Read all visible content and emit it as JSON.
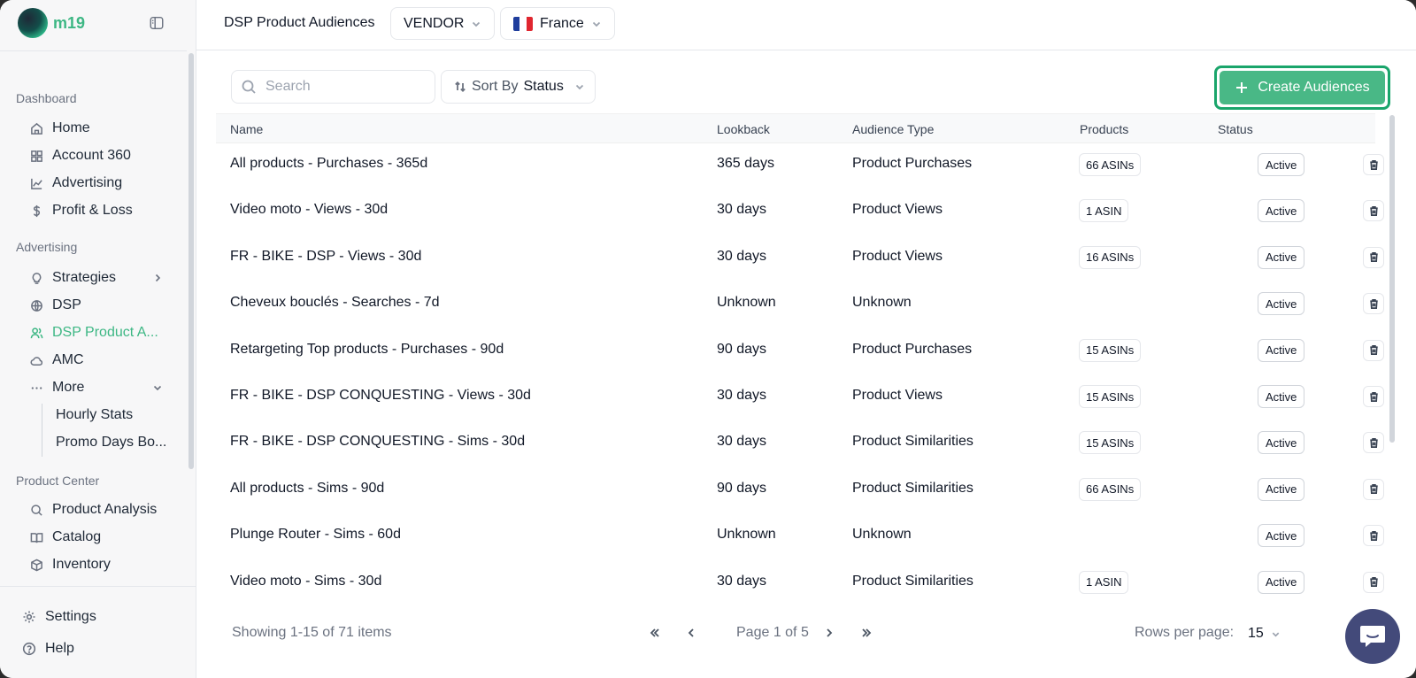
{
  "brand": {
    "name": "m19"
  },
  "sidebar": {
    "sections": [
      {
        "label": "Dashboard"
      },
      {
        "label": "Advertising"
      },
      {
        "label": "Product Center"
      }
    ],
    "items": [
      {
        "label": "Home",
        "icon": "home-icon"
      },
      {
        "label": "Account 360",
        "icon": "grid-icon"
      },
      {
        "label": "Advertising",
        "icon": "chart-line-icon"
      },
      {
        "label": "Profit & Loss",
        "icon": "dollar-icon"
      },
      {
        "label": "Strategies",
        "icon": "lightbulb-icon"
      },
      {
        "label": "DSP",
        "icon": "globe-icon"
      },
      {
        "label": "DSP Product A...",
        "icon": "users-icon",
        "active": true
      },
      {
        "label": "AMC",
        "icon": "cloud-icon"
      },
      {
        "label": "More",
        "icon": "ellipsis-icon"
      },
      {
        "label": "Product Analysis",
        "icon": "search-icon"
      },
      {
        "label": "Catalog",
        "icon": "book-icon"
      },
      {
        "label": "Inventory",
        "icon": "box-icon"
      }
    ],
    "sub_items": [
      "Hourly Stats",
      "Promo Days Bo..."
    ],
    "bottom": [
      {
        "label": "Settings",
        "icon": "gear-icon"
      },
      {
        "label": "Help",
        "icon": "help-icon"
      }
    ],
    "active_color": "#3db784"
  },
  "topbar": {
    "title": "DSP Product Audiences",
    "account_type": "VENDOR",
    "marketplace": "France"
  },
  "toolbar": {
    "search_placeholder": "Search",
    "sort_prefix": "Sort By",
    "sort_value": "Status",
    "create_label": "Create Audiences",
    "accent": "#49b886"
  },
  "table": {
    "columns": [
      "Name",
      "Lookback",
      "Audience Type",
      "Products",
      "Status"
    ],
    "rows": [
      {
        "name": "All products - Purchases - 365d",
        "lookback": "365 days",
        "type": "Product Purchases",
        "products": "66 ASINs",
        "status": "Active"
      },
      {
        "name": "Video moto - Views - 30d",
        "lookback": "30 days",
        "type": "Product Views",
        "products": "1 ASIN",
        "status": "Active"
      },
      {
        "name": "FR - BIKE - DSP - Views - 30d",
        "lookback": "30 days",
        "type": "Product Views",
        "products": "16 ASINs",
        "status": "Active"
      },
      {
        "name": "Cheveux bouclés - Searches - 7d",
        "lookback": "Unknown",
        "type": "Unknown",
        "products": "",
        "status": "Active"
      },
      {
        "name": "Retargeting Top products - Purchases - 90d",
        "lookback": "90 days",
        "type": "Product Purchases",
        "products": "15 ASINs",
        "status": "Active"
      },
      {
        "name": "FR - BIKE - DSP CONQUESTING - Views - 30d",
        "lookback": "30 days",
        "type": "Product Views",
        "products": "15 ASINs",
        "status": "Active"
      },
      {
        "name": "FR - BIKE - DSP CONQUESTING - Sims - 30d",
        "lookback": "30 days",
        "type": "Product Similarities",
        "products": "15 ASINs",
        "status": "Active"
      },
      {
        "name": "All products - Sims - 90d",
        "lookback": "90 days",
        "type": "Product Similarities",
        "products": "66 ASINs",
        "status": "Active"
      },
      {
        "name": "Plunge Router - Sims - 60d",
        "lookback": "Unknown",
        "type": "Unknown",
        "products": "",
        "status": "Active"
      },
      {
        "name": "Video moto - Sims - 30d",
        "lookback": "30 days",
        "type": "Product Similarities",
        "products": "1 ASIN",
        "status": "Active"
      }
    ]
  },
  "pagination": {
    "summary": "Showing 1-15 of 71 items",
    "page_label": "Page 1 of 5",
    "rows_per_page_label": "Rows per page:",
    "rows_per_page": "15"
  }
}
